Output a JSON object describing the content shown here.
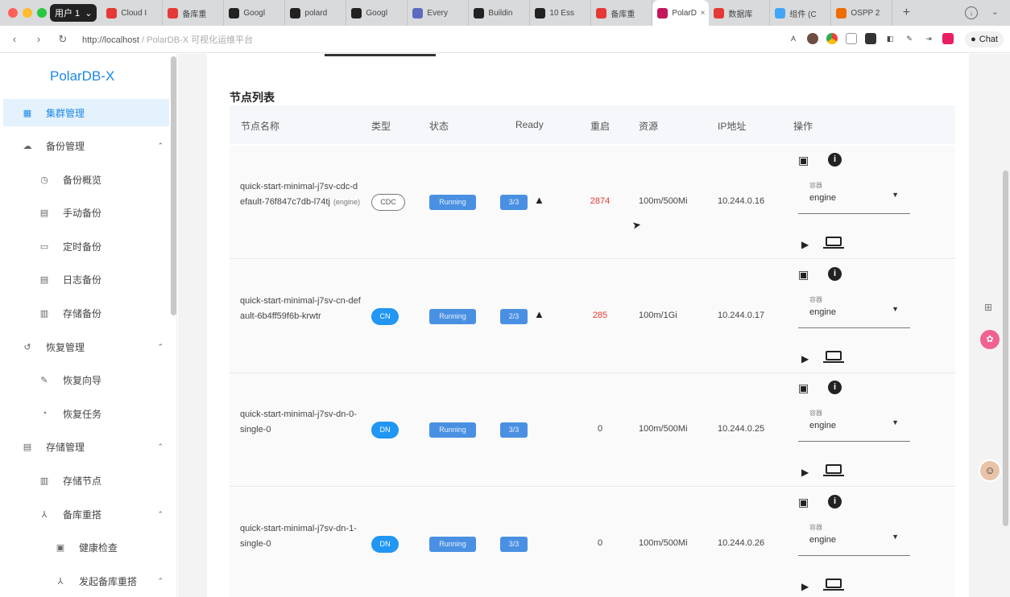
{
  "browser": {
    "profile_label": "用户 1",
    "tabs": [
      {
        "title": "Cloud I",
        "icon": "cloud-app-icon",
        "color": "#e53935"
      },
      {
        "title": "备库重",
        "icon": "red-question-icon",
        "color": "#e53935"
      },
      {
        "title": "Googl",
        "icon": "google-docs-icon",
        "color": "#222222"
      },
      {
        "title": "polard",
        "icon": "github-icon",
        "color": "#222222"
      },
      {
        "title": "Googl",
        "icon": "github-icon",
        "color": "#222222"
      },
      {
        "title": "Every",
        "icon": "hash-icon",
        "color": "#5c6bc0"
      },
      {
        "title": "Buildin",
        "icon": "x-logo-icon",
        "color": "#222222"
      },
      {
        "title": "10 Ess",
        "icon": "x-logo-icon",
        "color": "#222222"
      },
      {
        "title": "备库重",
        "icon": "red-question-icon",
        "color": "#e53935"
      },
      {
        "title": "PolarD",
        "icon": "angular-icon",
        "color": "#c2185b",
        "active": true
      },
      {
        "title": "数据库",
        "icon": "red-question-icon",
        "color": "#e53935"
      },
      {
        "title": "组件 (C",
        "icon": "cloud-app-icon",
        "color": "#42a5f5"
      },
      {
        "title": "OSPP 2",
        "icon": "cloud-app-icon",
        "color": "#ef6c00"
      }
    ],
    "url_host": "http://localhost",
    "url_title": " / PolarDB-X 可视化运维平台",
    "chat_label": "Chat"
  },
  "sidebar": {
    "brand": "PolarDB-X",
    "items": [
      {
        "label": "集群管理",
        "level": 0,
        "icon": "grid",
        "active": true
      },
      {
        "label": "备份管理",
        "level": 0,
        "icon": "cloud",
        "chevron": true
      },
      {
        "label": "备份概览",
        "level": 1,
        "icon": "clock"
      },
      {
        "label": "手动备份",
        "level": 1,
        "icon": "doc"
      },
      {
        "label": "定时备份",
        "level": 1,
        "icon": "calendar"
      },
      {
        "label": "日志备份",
        "level": 1,
        "icon": "doc"
      },
      {
        "label": "存储备份",
        "level": 1,
        "icon": "archive"
      },
      {
        "label": "恢复管理",
        "level": 0,
        "icon": "restore",
        "chevron": true
      },
      {
        "label": "恢复向导",
        "level": 1,
        "icon": "pencil"
      },
      {
        "label": "恢复任务",
        "level": 1,
        "icon": "history"
      },
      {
        "label": "存储管理",
        "level": 0,
        "icon": "storage",
        "chevron": true
      },
      {
        "label": "存储节点",
        "level": 1,
        "icon": "archive"
      },
      {
        "label": "备库重搭",
        "level": 1,
        "icon": "tree",
        "chevron": true
      },
      {
        "label": "健康检查",
        "level": 2,
        "icon": "check"
      },
      {
        "label": "发起备库重搭",
        "level": 2,
        "icon": "tree",
        "chevron": true
      }
    ]
  },
  "main": {
    "section_title": "节点列表",
    "columns": [
      "节点名称",
      "类型",
      "状态",
      "Ready",
      "重启",
      "资源",
      "IP地址",
      "操作"
    ],
    "rows": [
      {
        "name": "quick-start-minimal-j7sv-cdc-default-76f847c7db-l74tj",
        "role": "(engine)",
        "type": "CDC",
        "type_style": "outline",
        "status": "Running",
        "ready": "3/3",
        "warn": true,
        "restarts": "2874",
        "restart_alert": true,
        "resources": "100m/500Mi",
        "ip": "10.244.0.16",
        "select_label": "容器",
        "select_value": "engine"
      },
      {
        "name": "quick-start-minimal-j7sv-cn-default-6b4ff59f6b-krwtr",
        "role": "",
        "type": "CN",
        "type_style": "solid",
        "status": "Running",
        "ready": "2/3",
        "warn": true,
        "restarts": "285",
        "restart_alert": true,
        "resources": "100m/1Gi",
        "ip": "10.244.0.17",
        "select_label": "容器",
        "select_value": "engine"
      },
      {
        "name": "quick-start-minimal-j7sv-dn-0-single-0",
        "role": "",
        "type": "DN",
        "type_style": "solid",
        "status": "Running",
        "ready": "3/3",
        "warn": false,
        "restarts": "0",
        "restart_alert": false,
        "resources": "100m/500Mi",
        "ip": "10.244.0.25",
        "select_label": "容器",
        "select_value": "engine"
      },
      {
        "name": "quick-start-minimal-j7sv-dn-1-single-0",
        "role": "",
        "type": "DN",
        "type_style": "solid",
        "status": "Running",
        "ready": "3/3",
        "warn": false,
        "restarts": "0",
        "restart_alert": false,
        "resources": "100m/500Mi",
        "ip": "10.244.0.26",
        "select_label": "容器",
        "select_value": "engine"
      }
    ]
  },
  "colors": {
    "accent": "#1e88e5",
    "alert": "#e53935",
    "status_chip": "#4a90e2"
  }
}
